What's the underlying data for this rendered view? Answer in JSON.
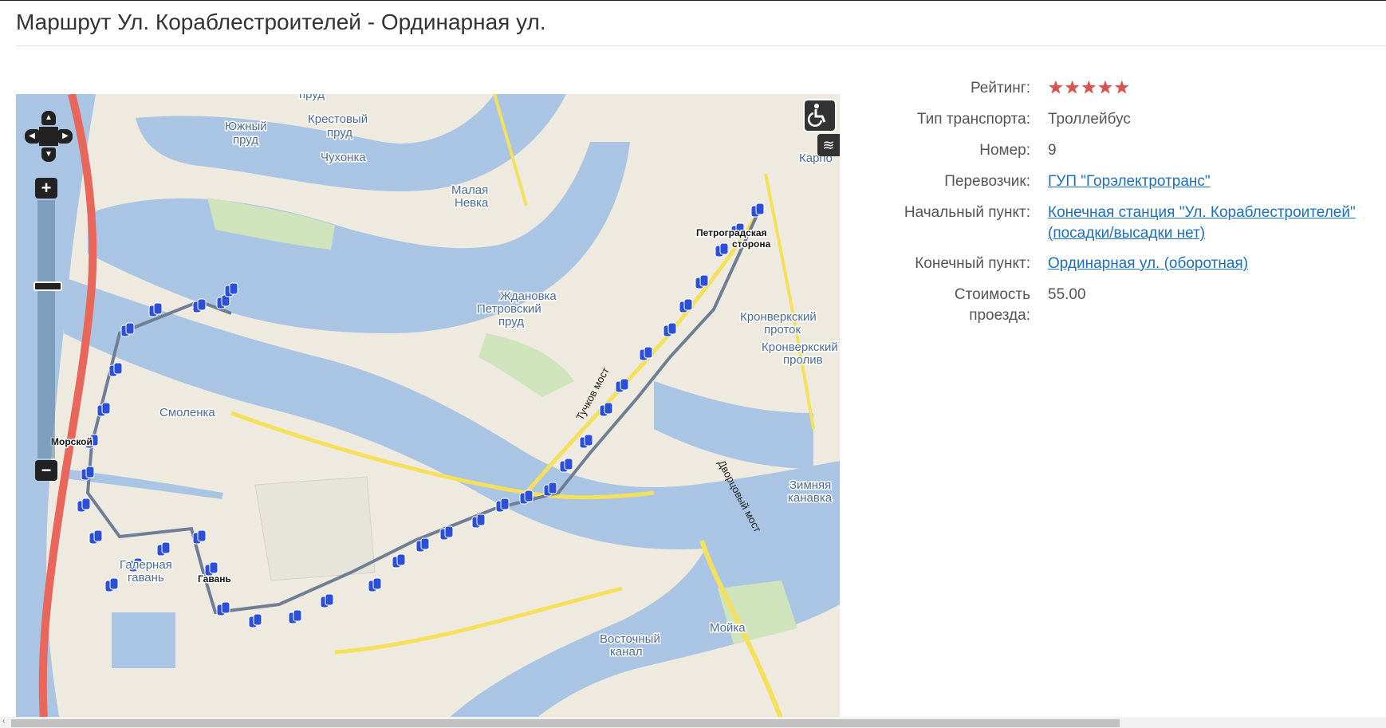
{
  "page": {
    "title": "Маршрут Ул. Кораблестроителей - Ординарная ул."
  },
  "info": {
    "rating_label": "Рейтинг:",
    "rating_value": 5,
    "rating_max": 5,
    "rating_stars": "★★★★★",
    "type_label": "Тип транспорта:",
    "type_value": "Троллейбус",
    "number_label": "Номер:",
    "number_value": "9",
    "carrier_label": "Перевозчик:",
    "carrier_value": "ГУП \"Горэлектротранс\"",
    "start_label": "Начальный пункт:",
    "start_line1": "Конечная станция \"Ул. Кораблестроителей\"",
    "start_line2": "(посадки/высадки нет)",
    "end_label": "Конечный пункт:",
    "end_value": "Ординарная ул. (оборотная)",
    "cost_label_line1": "Стоимость",
    "cost_label_line2": "проезда:",
    "cost_value": "55.00"
  },
  "map": {
    "labels": {
      "prud": "пруд",
      "yuzhny_1": "Южный",
      "yuzhny_2": "пруд",
      "krestovy_1": "Крестовый",
      "krestovy_2": "пруд",
      "chukhonka": "Чухонка",
      "malaya_nevka_1": "Малая",
      "malaya_nevka_2": "Невка",
      "zhdanovka": "Ждановка",
      "petrovsky_1": "Петровский",
      "petrovsky_2": "пруд",
      "petrogradskaya_1": "Петроградская",
      "petrogradskaya_2": "сторона",
      "kronverksky_protok_1": "Кронверкский",
      "kronverksky_protok_2": "проток",
      "kronverksky_proliv_1": "Кронверкский",
      "kronverksky_proliv_2": "пролив",
      "karpovka": "Карпо",
      "smolenka": "Смоленка",
      "morskoy": "Морской",
      "galernaya_1": "Галерная",
      "galernaya_2": "гавань",
      "gavan": "Гавань",
      "tuchkov": "Тучков мост",
      "dvortsovy": "Дворцовый мост",
      "zimnyaya_1": "Зимняя",
      "zimnyaya_2": "канавка",
      "moyka": "Мойка",
      "vostochny_1": "Восточный",
      "vostochny_2": "канал"
    },
    "colors": {
      "water": "#a9c5e3",
      "land": "#eeeadf",
      "park": "#cfe3bd",
      "road_major": "#f4e05a",
      "road_highway": "#e8675a",
      "route_line": "#6e7f95",
      "stop_marker": "#2c4fd8"
    },
    "controls": {
      "zoom_in": "+",
      "zoom_out": "−",
      "pan_up": "▲",
      "pan_down": "▼",
      "pan_left": "◀",
      "pan_right": "▶",
      "accessibility_icon": "wheelchair-icon",
      "layers_icon": "layers-icon"
    }
  }
}
